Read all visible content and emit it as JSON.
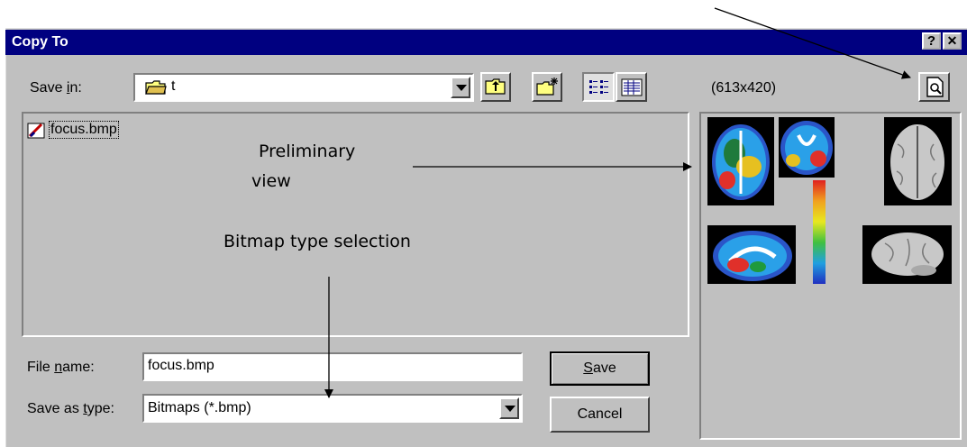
{
  "dialog": {
    "title": "Copy To",
    "help_glyph": "?",
    "close_glyph": "✕"
  },
  "toolbar": {
    "save_in_label": "Save in:",
    "save_in_value": "t",
    "icons": [
      "folder-icon",
      "up-one-level-icon",
      "new-folder-icon",
      "list-view-icon",
      "details-view-icon"
    ]
  },
  "file_list": {
    "items": [
      {
        "name": "focus.bmp",
        "icon": "bitmap-file-icon"
      }
    ]
  },
  "form": {
    "file_name_label": "File name:",
    "file_name_value": "focus.bmp",
    "save_as_type_label": "Save as type:",
    "save_as_type_value": "Bitmaps (*.bmp)",
    "save_button": "Save",
    "cancel_button": "Cancel"
  },
  "preview": {
    "dimensions": "(613x420)",
    "preview_button_icon": "preview-magnifier-icon"
  },
  "annotations": {
    "preliminary": "Preliminary",
    "view": "view",
    "bitmap_type": "Bitmap type selection"
  },
  "colors": {
    "title_bar": "#000080",
    "dialog_face": "#c0c0c0"
  }
}
